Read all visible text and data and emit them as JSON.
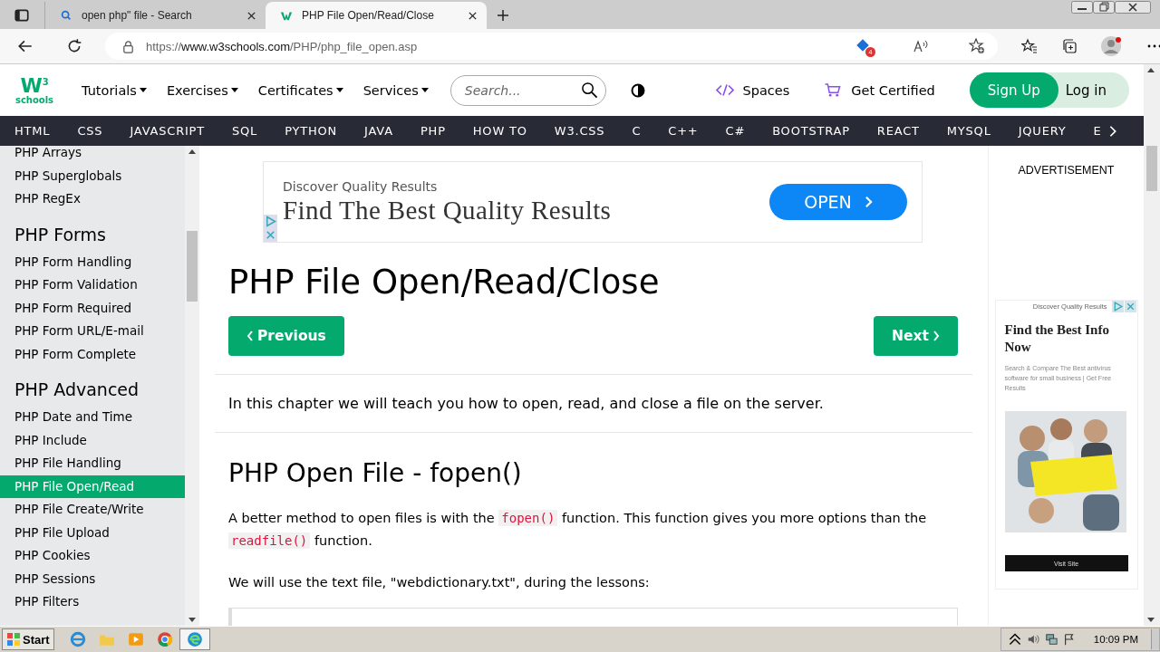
{
  "browser": {
    "tabs": [
      {
        "title": "open php\" file - Search",
        "kind": "search",
        "selected": false
      },
      {
        "title": "PHP File Open/Read/Close",
        "kind": "site",
        "selected": true
      }
    ],
    "url": {
      "scheme": "https://",
      "host": "www.w3schools.com",
      "path": "/PHP/php_file_open.asp"
    },
    "extension_badge": "4"
  },
  "header": {
    "logo": {
      "mark": "W",
      "sup": "3",
      "word": "schools"
    },
    "menus": [
      "Tutorials",
      "Exercises",
      "Certificates",
      "Services"
    ],
    "search": {
      "placeholder": "Search..."
    },
    "spaces": "Spaces",
    "get_certified": "Get Certified",
    "sign_up": "Sign Up",
    "log_in": "Log in"
  },
  "topnav": [
    "HTML",
    "CSS",
    "JAVASCRIPT",
    "SQL",
    "PYTHON",
    "JAVA",
    "PHP",
    "HOW TO",
    "W3.CSS",
    "C",
    "C++",
    "C#",
    "BOOTSTRAP",
    "REACT",
    "MYSQL",
    "JQUERY",
    "E"
  ],
  "sidebar": [
    {
      "kind": "item",
      "label": "PHP Arrays",
      "selected": false
    },
    {
      "kind": "item",
      "label": "PHP Superglobals",
      "selected": false
    },
    {
      "kind": "item",
      "label": "PHP RegEx",
      "selected": false
    },
    {
      "kind": "heading",
      "label": "PHP Forms"
    },
    {
      "kind": "item",
      "label": "PHP Form Handling",
      "selected": false
    },
    {
      "kind": "item",
      "label": "PHP Form Validation",
      "selected": false
    },
    {
      "kind": "item",
      "label": "PHP Form Required",
      "selected": false
    },
    {
      "kind": "item",
      "label": "PHP Form URL/E-mail",
      "selected": false
    },
    {
      "kind": "item",
      "label": "PHP Form Complete",
      "selected": false
    },
    {
      "kind": "heading",
      "label": "PHP Advanced"
    },
    {
      "kind": "item",
      "label": "PHP Date and Time",
      "selected": false
    },
    {
      "kind": "item",
      "label": "PHP Include",
      "selected": false
    },
    {
      "kind": "item",
      "label": "PHP File Handling",
      "selected": false
    },
    {
      "kind": "item",
      "label": "PHP File Open/Read",
      "selected": true
    },
    {
      "kind": "item",
      "label": "PHP File Create/Write",
      "selected": false
    },
    {
      "kind": "item",
      "label": "PHP File Upload",
      "selected": false
    },
    {
      "kind": "item",
      "label": "PHP Cookies",
      "selected": false
    },
    {
      "kind": "item",
      "label": "PHP Sessions",
      "selected": false
    },
    {
      "kind": "item",
      "label": "PHP Filters",
      "selected": false
    }
  ],
  "main": {
    "ad": {
      "kicker": "Discover Quality Results",
      "headline": "Find The Best Quality Results",
      "button": "OPEN"
    },
    "title": "PHP File Open/Read/Close",
    "previous": "Previous",
    "next": "Next",
    "intro": "In this chapter we will teach you how to open, read, and close a file on the server.",
    "section_title": "PHP Open File - fopen()",
    "paragraph": [
      {
        "kind": "text",
        "text": "A better method to open files is with the "
      },
      {
        "kind": "code",
        "text": "fopen()"
      },
      {
        "kind": "text",
        "text": " function. This function gives you more options than the "
      },
      {
        "kind": "code",
        "text": "readfile()"
      },
      {
        "kind": "text",
        "text": " function."
      }
    ],
    "note": "We will use the text file, \"webdictionary.txt\", during the lessons:"
  },
  "right": {
    "label": "ADVERTISEMENT",
    "ad": {
      "kicker": "Discover Quality Results",
      "headline": "Find the Best Info Now",
      "body": "Search & Compare The Best antivirus software for small business | Get Free Results",
      "button": "Visit Site"
    }
  },
  "taskbar": {
    "start": "Start",
    "time": "10:09 PM"
  }
}
